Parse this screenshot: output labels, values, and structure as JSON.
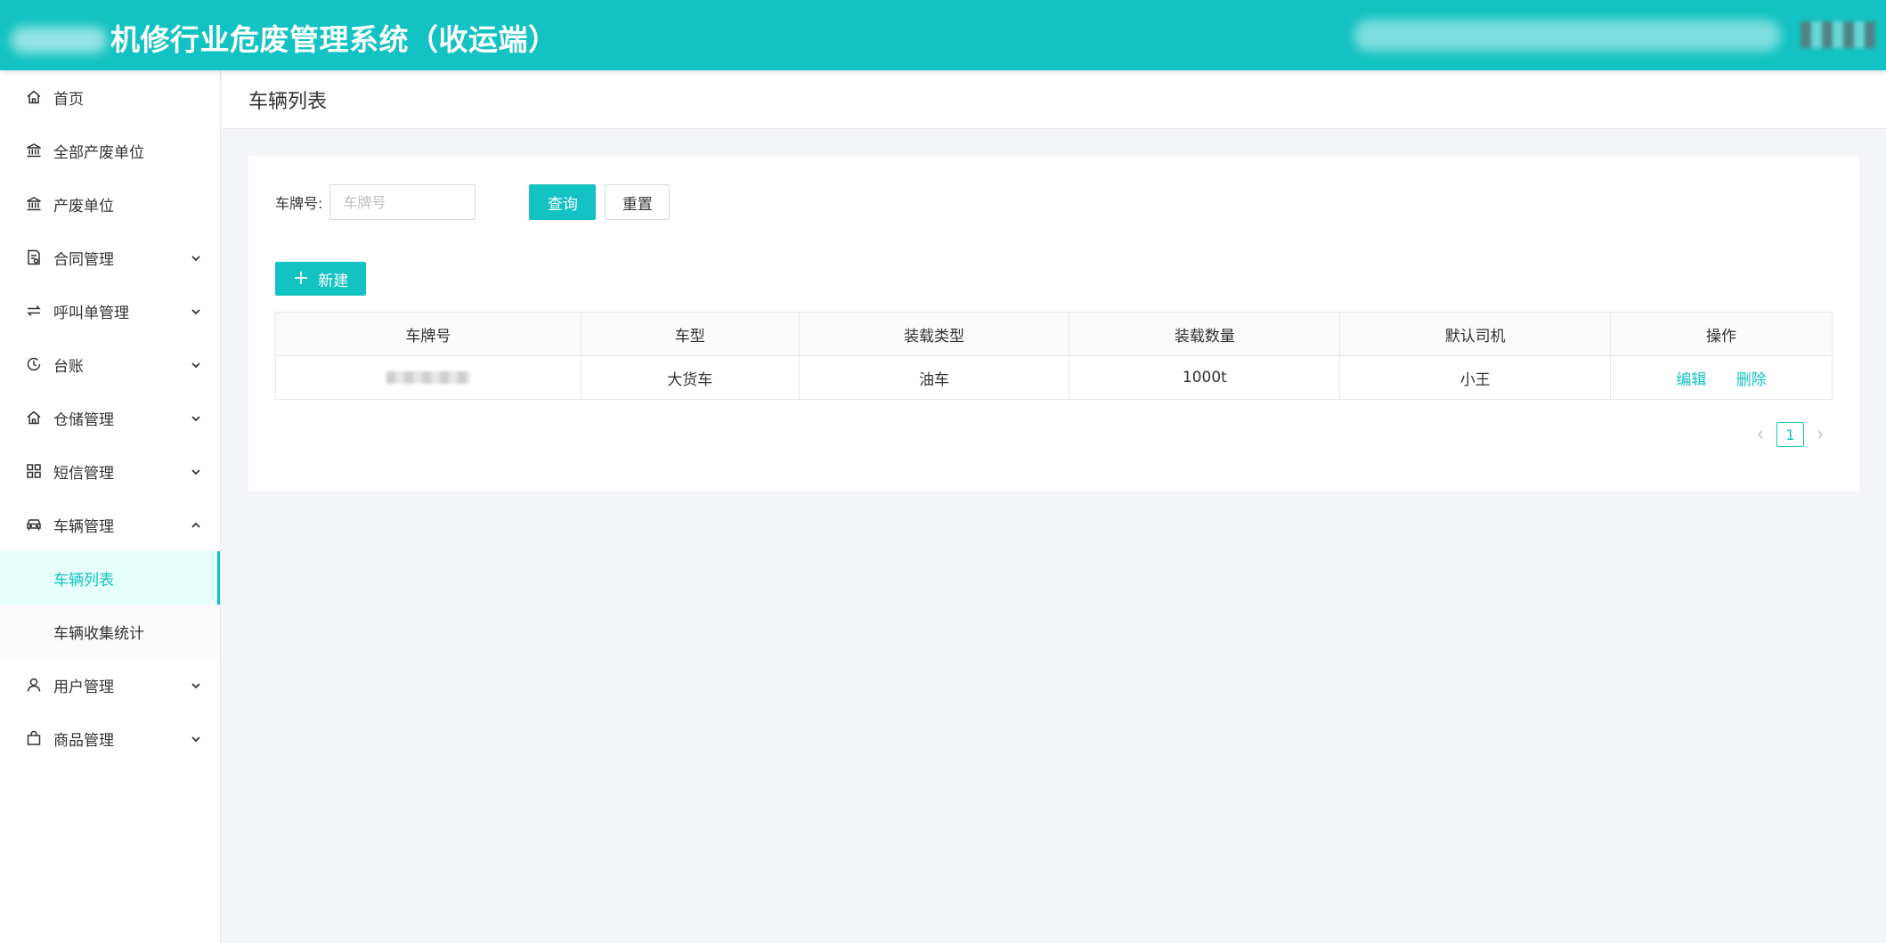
{
  "header": {
    "title": "机修行业危废管理系统（收运端）"
  },
  "sidebar": {
    "items": [
      {
        "label": "首页",
        "icon": "home-icon",
        "has_arrow": false
      },
      {
        "label": "全部产废单位",
        "icon": "bank-icon",
        "has_arrow": false
      },
      {
        "label": "产废单位",
        "icon": "bank-icon",
        "has_arrow": false
      },
      {
        "label": "合同管理",
        "icon": "contract-icon",
        "has_arrow": true,
        "expanded": false
      },
      {
        "label": "呼叫单管理",
        "icon": "swap-icon",
        "has_arrow": true,
        "expanded": false
      },
      {
        "label": "台账",
        "icon": "history-icon",
        "has_arrow": true,
        "expanded": false
      },
      {
        "label": "仓储管理",
        "icon": "home-icon",
        "has_arrow": true,
        "expanded": false
      },
      {
        "label": "短信管理",
        "icon": "appstore-icon",
        "has_arrow": true,
        "expanded": false
      },
      {
        "label": "车辆管理",
        "icon": "car-icon",
        "has_arrow": true,
        "expanded": true,
        "children": [
          {
            "label": "车辆列表",
            "active": true
          },
          {
            "label": "车辆收集统计",
            "active": false
          }
        ]
      },
      {
        "label": "用户管理",
        "icon": "user-icon",
        "has_arrow": true,
        "expanded": false
      },
      {
        "label": "商品管理",
        "icon": "shopping-icon",
        "has_arrow": true,
        "expanded": false
      }
    ]
  },
  "page": {
    "title": "车辆列表"
  },
  "search": {
    "label": "车牌号:",
    "placeholder": "车牌号",
    "value": "",
    "query_label": "查询",
    "reset_label": "重置"
  },
  "toolbar": {
    "new_label": "新建"
  },
  "table": {
    "columns": [
      "车牌号",
      "车型",
      "装载类型",
      "装载数量",
      "默认司机",
      "操作"
    ],
    "rows": [
      {
        "vehicle_type": "大货车",
        "load_type": "油车",
        "load_quantity": "1000t",
        "default_driver": "小王",
        "edit_label": "编辑",
        "delete_label": "删除"
      }
    ]
  },
  "pagination": {
    "current_page": "1"
  },
  "colors": {
    "primary": "#13c2c2",
    "active_bg": "#e6fffb",
    "page_bg": "#f4f5f9"
  }
}
